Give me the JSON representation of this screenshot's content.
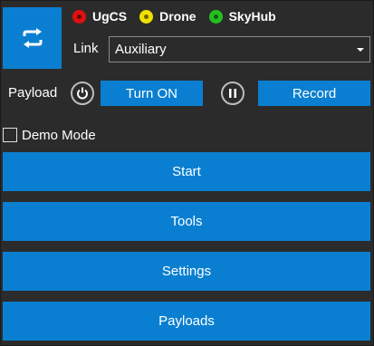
{
  "status": [
    {
      "label": "UgCS",
      "color": "#e01010"
    },
    {
      "label": "Drone",
      "color": "#f0e000"
    },
    {
      "label": "SkyHub",
      "color": "#22c020"
    }
  ],
  "link": {
    "label": "Link",
    "selected": "Auxiliary"
  },
  "payload": {
    "label": "Payload",
    "turn_on_label": "Turn ON",
    "record_label": "Record"
  },
  "demo_mode": {
    "label": "Demo Mode",
    "checked": false
  },
  "menu": {
    "start": "Start",
    "tools": "Tools",
    "settings": "Settings",
    "payloads": "Payloads"
  },
  "colors": {
    "accent": "#0a7fd1",
    "background": "#2b2b2b"
  },
  "icons": {
    "sync": "sync-icon",
    "power": "power-icon",
    "pause": "pause-icon"
  }
}
